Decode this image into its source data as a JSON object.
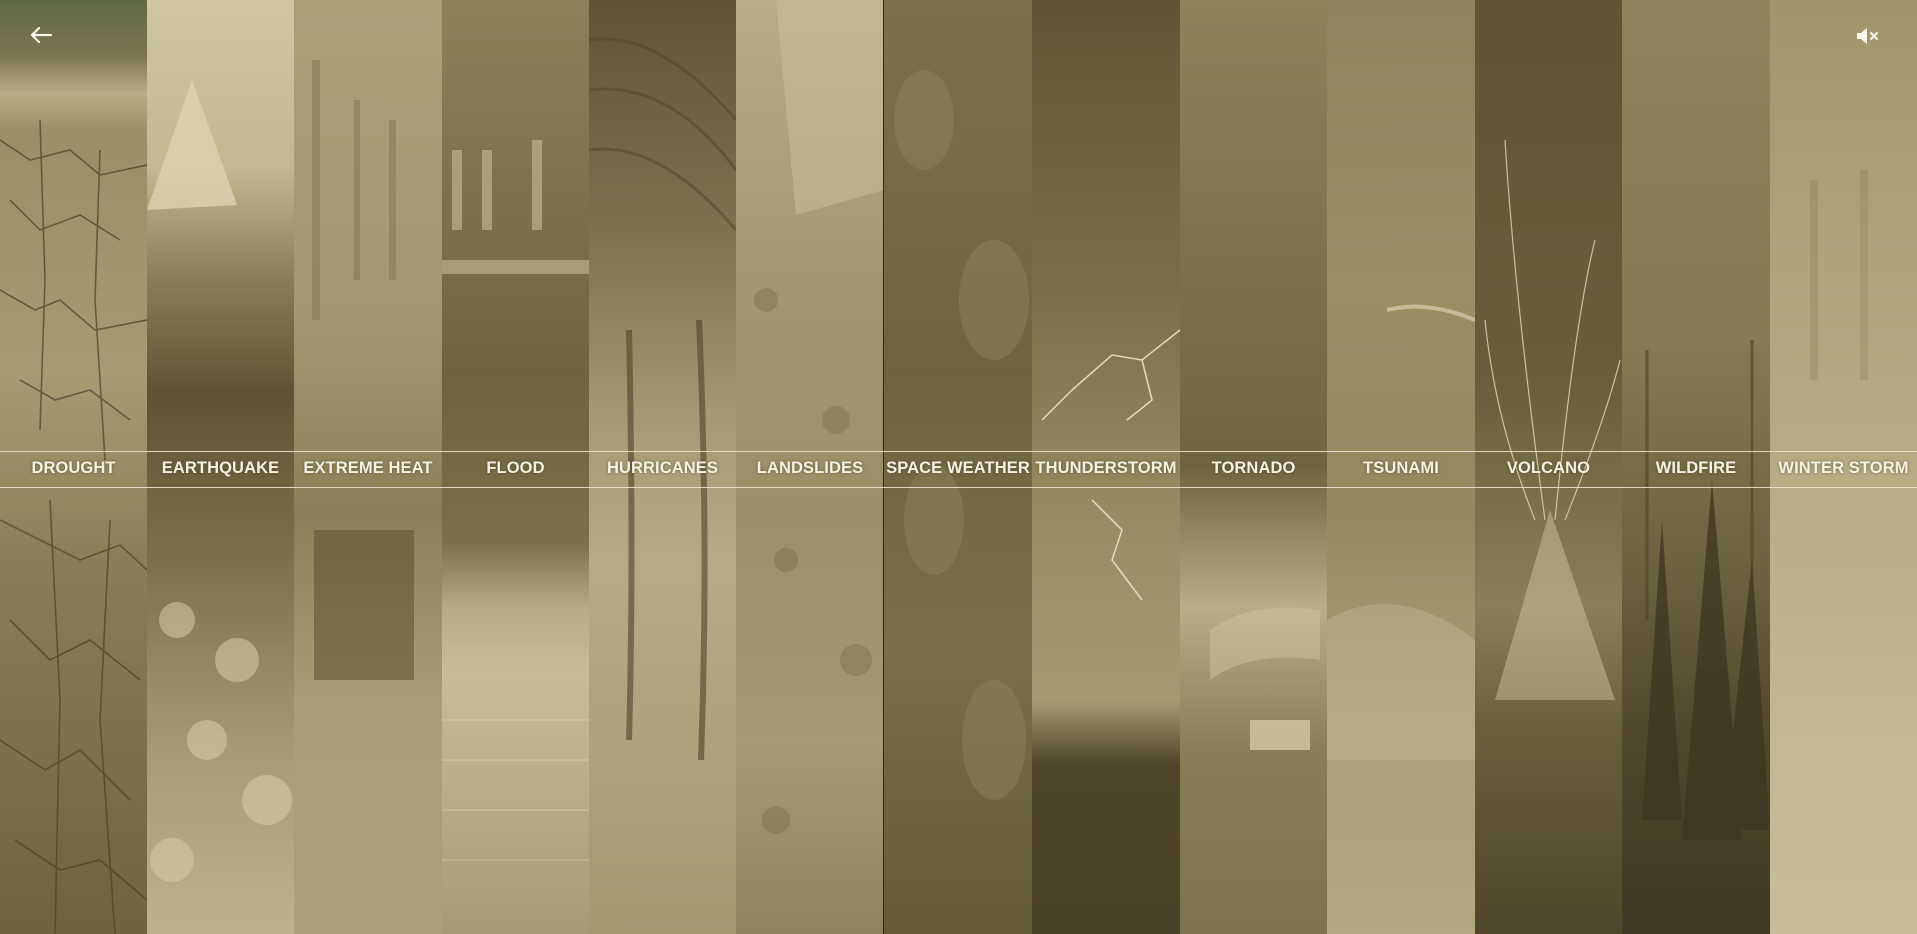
{
  "nav": {
    "back_icon": "arrow-left-icon",
    "mute_icon": "speaker-muted-icon"
  },
  "categories": [
    {
      "label": "DROUGHT",
      "bg": "#8f835a"
    },
    {
      "label": "EARTHQUAKE",
      "bg": "#9d9068"
    },
    {
      "label": "EXTREME HEAT",
      "bg": "#a4976c"
    },
    {
      "label": "FLOOD",
      "bg": "#8e8158"
    },
    {
      "label": "HURRICANES",
      "bg": "#a0936a"
    },
    {
      "label": "LANDSLIDES",
      "bg": "#a19470"
    },
    {
      "label": "SPACE WEATHER",
      "bg": "#7a6e48"
    },
    {
      "label": "THUNDERSTORM",
      "bg": "#6f6440"
    },
    {
      "label": "TORNADO",
      "bg": "#8a7e56"
    },
    {
      "label": "TSUNAMI",
      "bg": "#958961"
    },
    {
      "label": "VOLCANO",
      "bg": "#6a5f3c"
    },
    {
      "label": "WILDFIRE",
      "bg": "#7d7149"
    },
    {
      "label": "WINTER STORM",
      "bg": "#b6aa83"
    }
  ]
}
